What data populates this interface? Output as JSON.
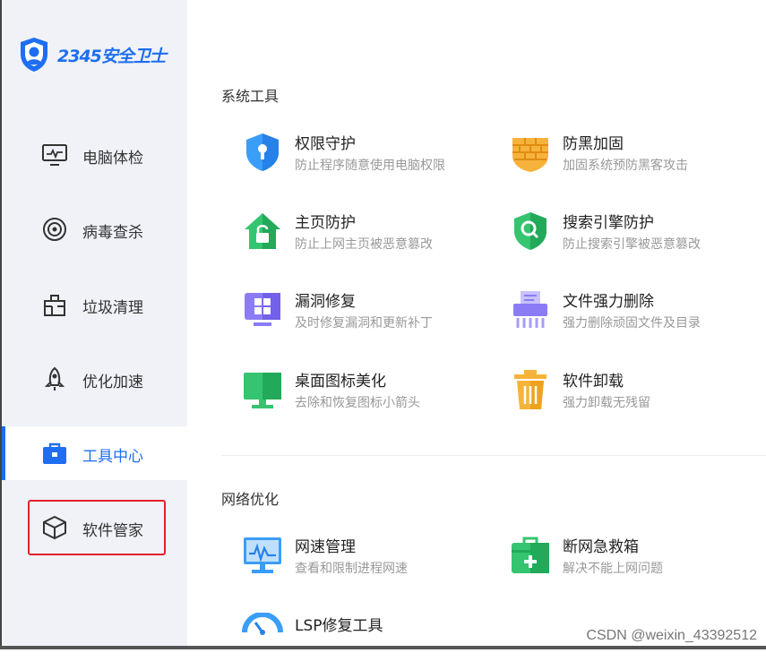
{
  "app": {
    "logo_text": "2345安全卫士"
  },
  "sidebar": {
    "items": [
      {
        "label": "电脑体检",
        "icon": "monitor-icon"
      },
      {
        "label": "病毒查杀",
        "icon": "target-icon"
      },
      {
        "label": "垃圾清理",
        "icon": "trash-bag-icon"
      },
      {
        "label": "优化加速",
        "icon": "rocket-icon"
      },
      {
        "label": "工具中心",
        "icon": "toolbox-icon",
        "active": true
      },
      {
        "label": "软件管家",
        "icon": "cube-icon",
        "highlighted": true
      }
    ]
  },
  "main": {
    "sections": [
      {
        "title": "系统工具",
        "tools": [
          {
            "name": "权限守护",
            "desc": "防止程序随意使用电脑权限",
            "icon": "shield-key-icon"
          },
          {
            "name": "防黑加固",
            "desc": "加固系统预防黑客攻击",
            "icon": "brick-wall-icon"
          },
          {
            "name": "主页防护",
            "desc": "防止上网主页被恶意篡改",
            "icon": "home-lock-icon"
          },
          {
            "name": "搜索引擎防护",
            "desc": "防止搜索引擎被恶意篡改",
            "icon": "search-shield-icon"
          },
          {
            "name": "漏洞修复",
            "desc": "及时修复漏洞和更新补丁",
            "icon": "windows-icon"
          },
          {
            "name": "文件强力删除",
            "desc": "强力删除顽固文件及目录",
            "icon": "shredder-icon"
          },
          {
            "name": "桌面图标美化",
            "desc": "去除和恢复图标小箭头",
            "icon": "desktop-icon"
          },
          {
            "name": "软件卸载",
            "desc": "强力卸载无残留",
            "icon": "bin-icon"
          }
        ]
      },
      {
        "title": "网络优化",
        "tools": [
          {
            "name": "网速管理",
            "desc": "查看和限制进程网速",
            "icon": "speed-monitor-icon"
          },
          {
            "name": "断网急救箱",
            "desc": "解决不能上网问题",
            "icon": "first-aid-icon"
          },
          {
            "name": "LSP修复工具",
            "desc": "",
            "icon": "gauge-icon"
          }
        ]
      }
    ]
  },
  "watermark": "CSDN @weixin_43392512",
  "colors": {
    "accent": "#1d6ef2",
    "highlight_border": "#e3202a",
    "sidebar_bg": "#f0f2f8"
  }
}
